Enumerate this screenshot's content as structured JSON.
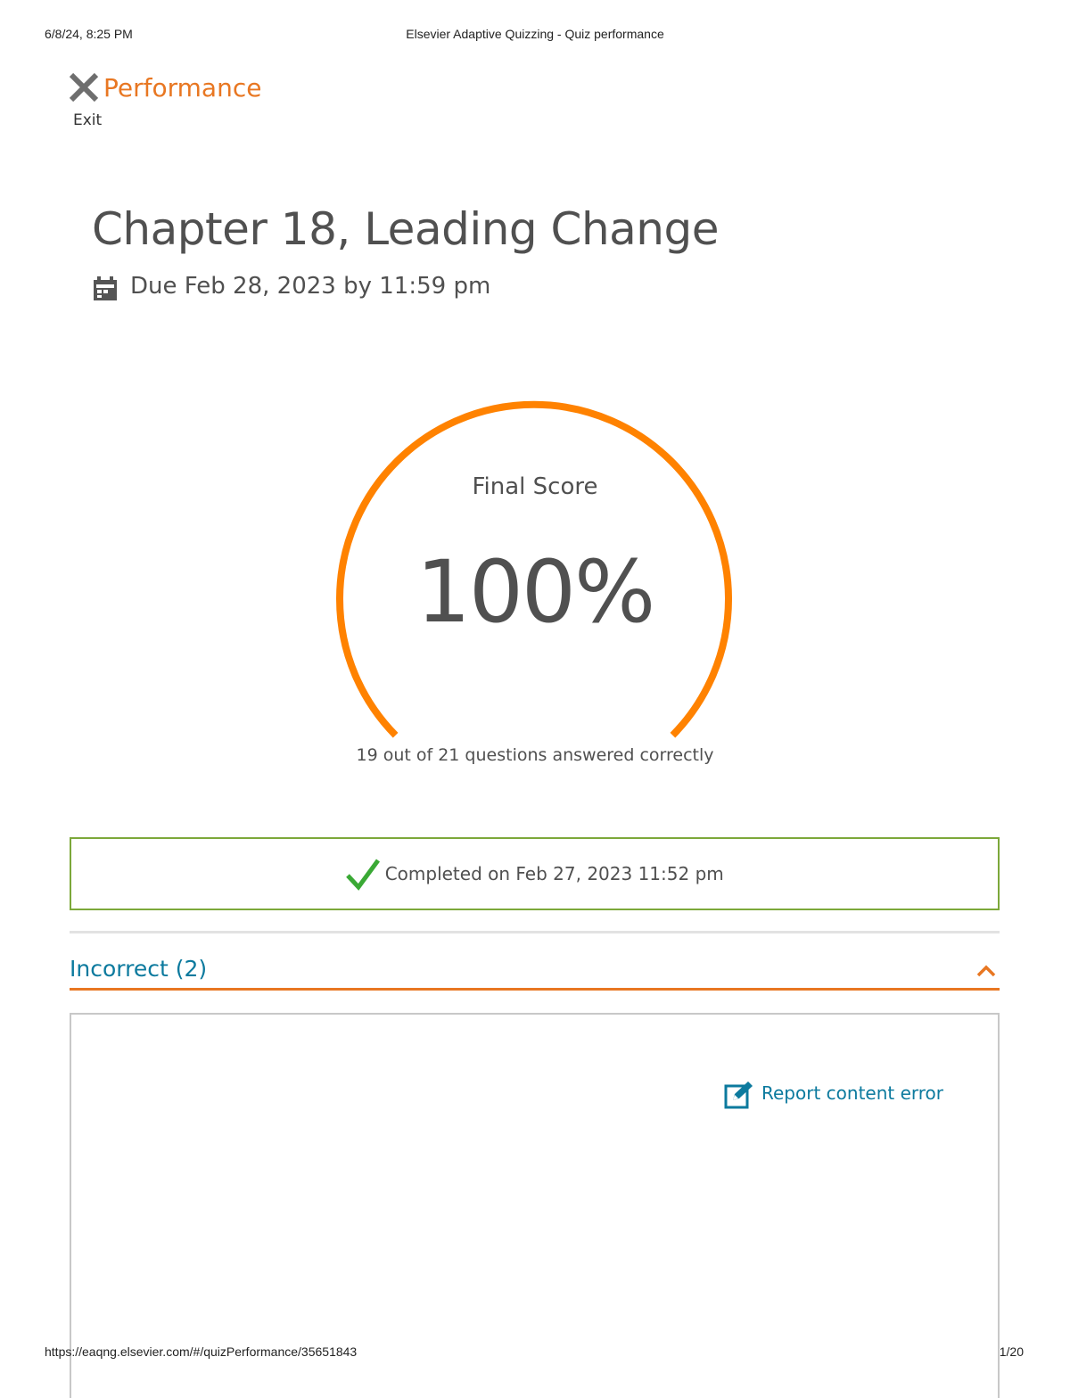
{
  "print_header": {
    "datetime": "6/8/24, 8:25 PM",
    "page_title": "Elsevier Adaptive Quizzing - Quiz performance"
  },
  "print_footer": {
    "url": "https://eaqng.elsevier.com/#/quizPerformance/35651843",
    "page_number": "1/20"
  },
  "header": {
    "exit_label": "Exit",
    "title": "Performance",
    "accent_color": "#e87722"
  },
  "quiz": {
    "title": "Chapter 18, Leading Change",
    "due": "Due Feb 28, 2023 by 11:59 pm"
  },
  "score": {
    "label": "Final Score",
    "value": "100%",
    "summary": "19 out of 21 questions answered correctly",
    "gauge_color": "#ff8200"
  },
  "completion": {
    "text": "Completed on Feb 27, 2023 11:52 pm",
    "border_color": "#7ca83a",
    "check_color": "#3aa935"
  },
  "incorrect_section": {
    "title": "Incorrect (2)",
    "expanded": true,
    "report_label": "Report content error",
    "link_color": "#0c7a9e"
  }
}
